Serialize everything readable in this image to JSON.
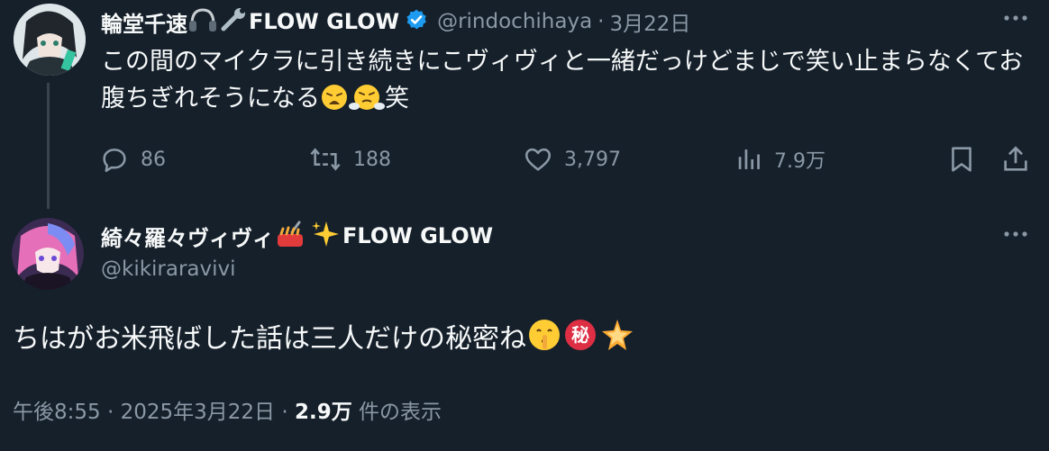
{
  "parent_tweet": {
    "author_name": "輪堂千速",
    "author_suffix": "FLOW GLOW",
    "handle": "@rindochihaya",
    "separator": "·",
    "date": "3月22日",
    "text": "この間のマイクラに引き続きにこヴィヴィと一緒だっけどまじで笑い止まらなくてお腹ちぎれそうになる",
    "text_tail": "笑",
    "reply_count": "86",
    "retweet_count": "188",
    "like_count": "3,797",
    "view_count": "7.9万"
  },
  "reply_tweet": {
    "author_name": "綺々羅々ヴィヴィ",
    "author_suffix": "FLOW GLOW",
    "handle": "@kikiraravivi",
    "text": "ちはがお米飛ばした話は三人だけの秘密ね",
    "timestamp": "午後8:55 · 2025年3月22日 · ",
    "views_num": "2.9万",
    "views_label": " 件の表示"
  },
  "icons": {
    "verified": "verified-badge-icon",
    "more": "more-options-icon",
    "reply": "reply-icon",
    "retweet": "retweet-icon",
    "like": "heart-icon",
    "views": "views-chart-icon",
    "bookmark": "bookmark-icon",
    "share": "share-icon"
  },
  "colors": {
    "background": "#15202b",
    "text_primary": "#f7f9f9",
    "text_secondary": "#8b98a5",
    "verified_blue": "#1d9bf0",
    "thread_line": "#38444d"
  }
}
